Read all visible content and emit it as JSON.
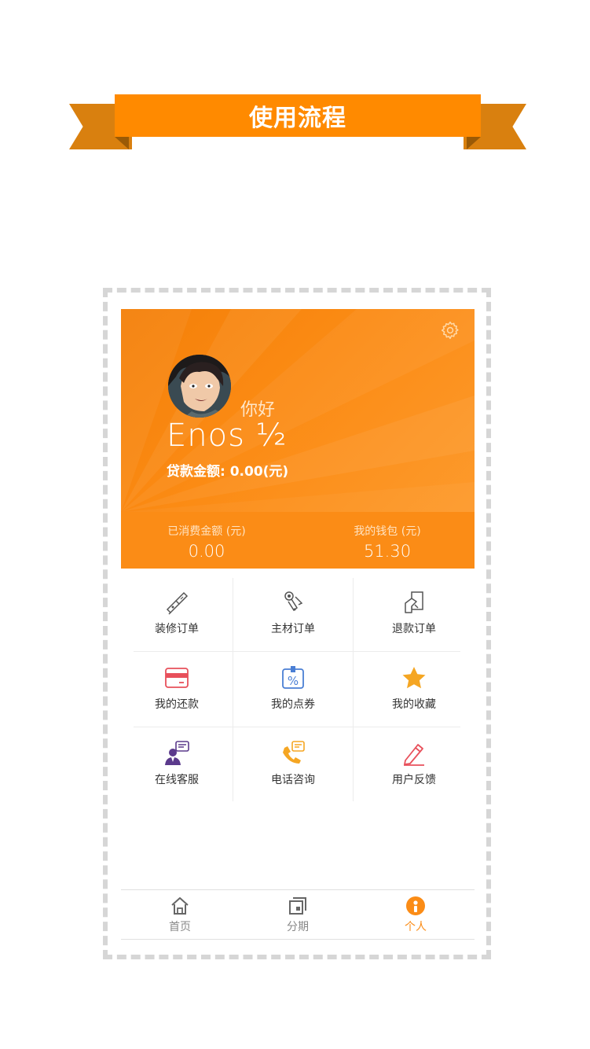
{
  "banner": {
    "title": "使用流程"
  },
  "profile": {
    "greeting": "你好",
    "username": "Enos ½",
    "loan_label": "贷款金额: 0.00(元)"
  },
  "stats": [
    {
      "label": "已消费金额 (元)",
      "value": "0.00"
    },
    {
      "label": "我的钱包 (元)",
      "value": "51.30"
    }
  ],
  "menu": [
    {
      "label": "装修订单",
      "icon": "decoration-tool-icon"
    },
    {
      "label": "主材订单",
      "icon": "materials-icon"
    },
    {
      "label": "退款订单",
      "icon": "refund-icon"
    },
    {
      "label": "我的还款",
      "icon": "card-icon"
    },
    {
      "label": "我的点券",
      "icon": "coupon-icon"
    },
    {
      "label": "我的收藏",
      "icon": "star-icon"
    },
    {
      "label": "在线客服",
      "icon": "customer-service-icon"
    },
    {
      "label": "电话咨询",
      "icon": "phone-icon"
    },
    {
      "label": "用户反馈",
      "icon": "feedback-pencil-icon"
    }
  ],
  "tabs": [
    {
      "label": "首页",
      "icon": "home-icon"
    },
    {
      "label": "分期",
      "icon": "installment-icon"
    },
    {
      "label": "个人",
      "icon": "person-icon"
    }
  ],
  "colors": {
    "accent": "#fb8c16",
    "ribbon": "#ff8a00",
    "frame": "#d6d6d6"
  }
}
